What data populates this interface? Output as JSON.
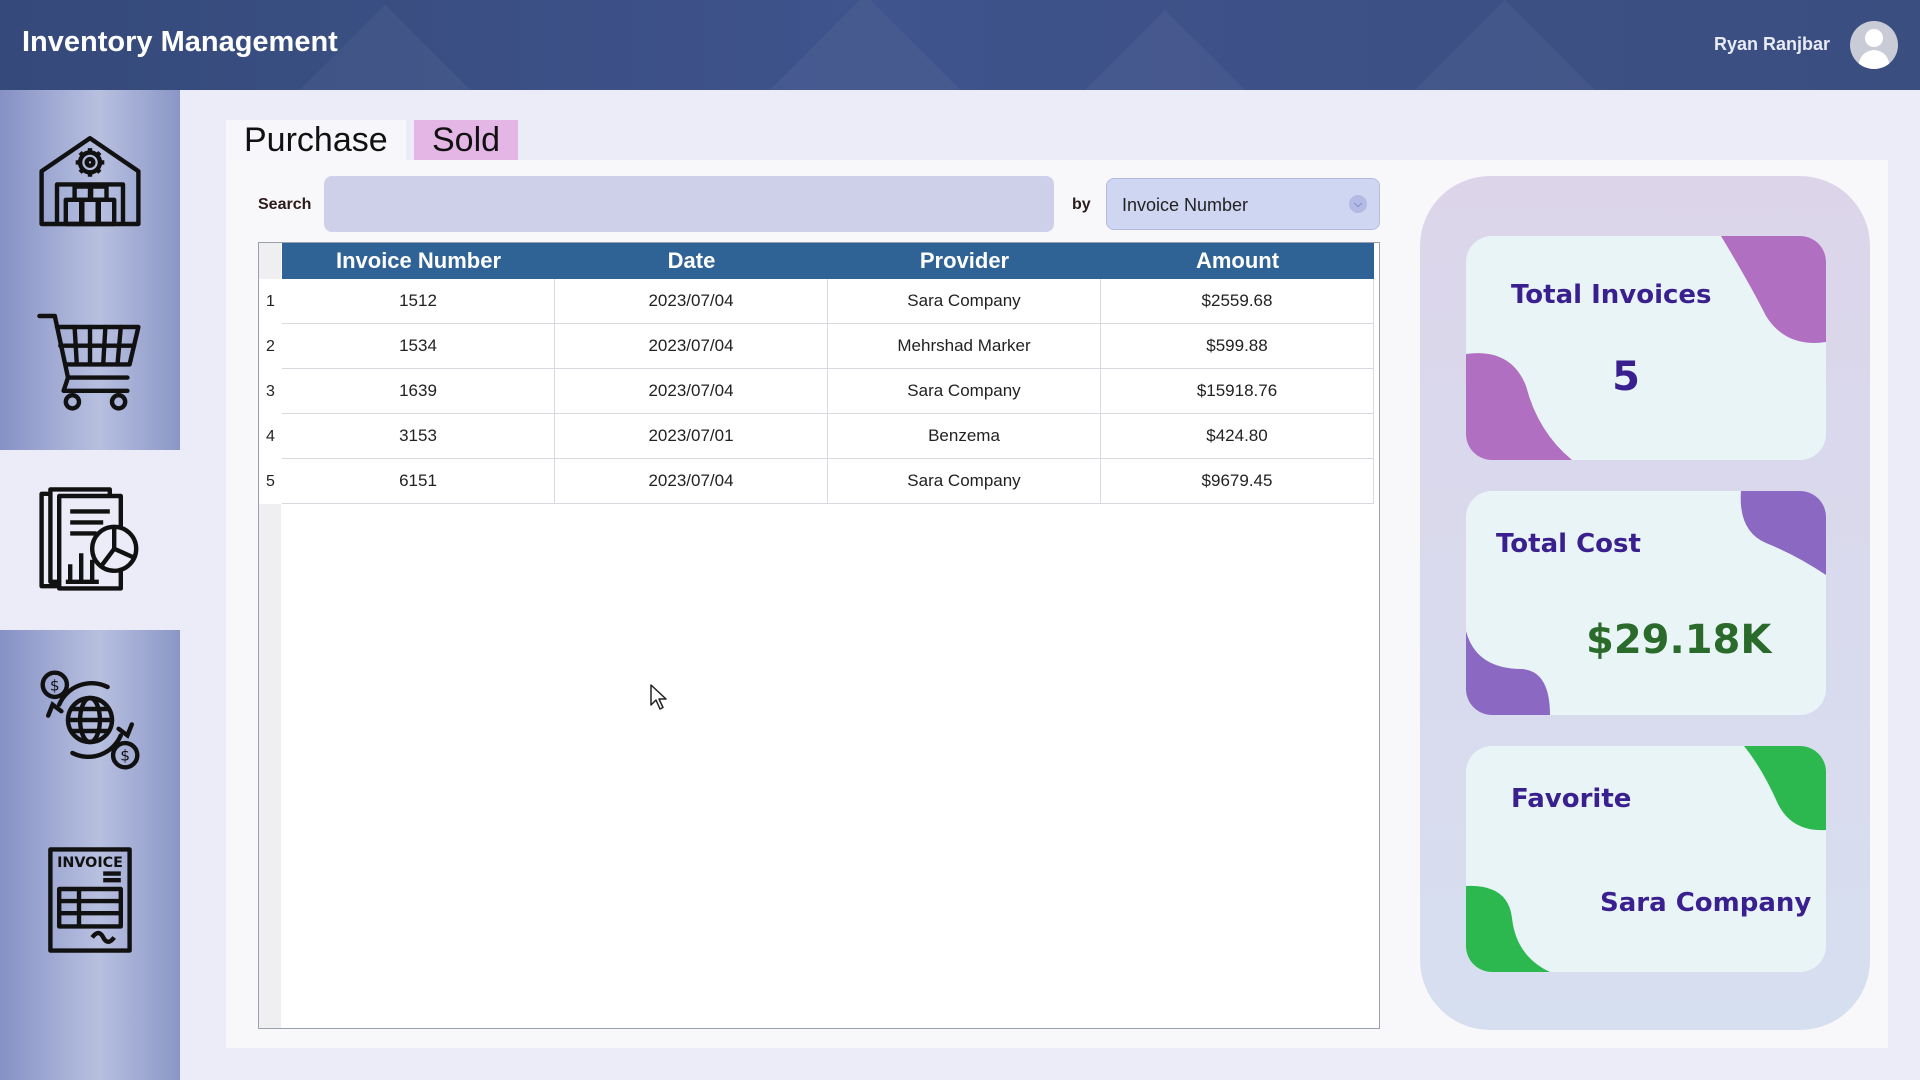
{
  "app": {
    "title": "Inventory Management",
    "user": "Ryan Ranjbar"
  },
  "sidebar": {
    "items": [
      {
        "icon": "warehouse-icon",
        "active": false
      },
      {
        "icon": "shopping-cart-icon",
        "active": false
      },
      {
        "icon": "report-documents-icon",
        "active": true
      },
      {
        "icon": "global-currency-exchange-icon",
        "active": false
      },
      {
        "icon": "invoice-icon",
        "active": false
      }
    ]
  },
  "tabs": [
    {
      "label": "Purchase",
      "active": true
    },
    {
      "label": "Sold",
      "active": false
    }
  ],
  "search": {
    "label": "Search",
    "value": "",
    "by_label": "by",
    "by_value": "Invoice Number"
  },
  "table": {
    "columns": [
      "Invoice Number",
      "Date",
      "Provider",
      "Amount"
    ],
    "rows": [
      {
        "num": "1",
        "invoice": "1512",
        "date": "2023/07/04",
        "provider": "Sara Company",
        "amount": "$2559.68"
      },
      {
        "num": "2",
        "invoice": "1534",
        "date": "2023/07/04",
        "provider": "Mehrshad Marker",
        "amount": "$599.88"
      },
      {
        "num": "3",
        "invoice": "1639",
        "date": "2023/07/04",
        "provider": "Sara Company",
        "amount": "$15918.76"
      },
      {
        "num": "4",
        "invoice": "3153",
        "date": "2023/07/01",
        "provider": "Benzema",
        "amount": "$424.80"
      },
      {
        "num": "5",
        "invoice": "6151",
        "date": "2023/07/04",
        "provider": "Sara Company",
        "amount": "$9679.45"
      }
    ]
  },
  "stats": {
    "total_invoices": {
      "title": "Total Invoices",
      "value": "5",
      "accent": "#b06fc0"
    },
    "total_cost": {
      "title": "Total Cost",
      "value": "$29.18K",
      "accent": "#8b68c2",
      "value_color": "#2a6a2a"
    },
    "favorite": {
      "title": "Favorite",
      "value": "Sara Company",
      "accent": "#2cb84e"
    }
  },
  "colors": {
    "header": "#3b4f84",
    "table_header": "#2f6396",
    "sold_tab": "#e4b6e6",
    "search_field": "#cdd0e8",
    "card_text": "#3a1f8f"
  }
}
